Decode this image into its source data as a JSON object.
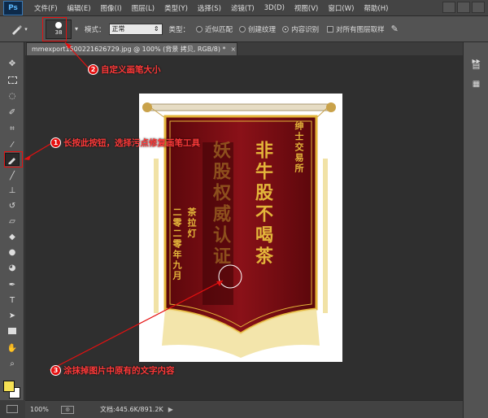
{
  "menubar": {
    "logo": "Ps",
    "items": [
      "文件(F)",
      "编辑(E)",
      "图像(I)",
      "图层(L)",
      "类型(Y)",
      "选择(S)",
      "滤镜(T)",
      "3D(D)",
      "视图(V)",
      "窗口(W)",
      "帮助(H)"
    ]
  },
  "options": {
    "brush_size": "38",
    "mode_label": "模式：",
    "mode_value": "正常",
    "type_label": "类型：",
    "radio_proximity": "近似匹配",
    "radio_texture": "创建纹理",
    "radio_content": "内容识别",
    "check_all_layers": "对所有图层取样"
  },
  "document": {
    "tab_title": "mmexport1500221626729.jpg @ 100% (背景 拷贝, RGB/8) *",
    "close": "×",
    "banner_right": "绅士交易所",
    "banner_main_right": "非牛股不喝茶",
    "banner_main_left_residue": "妖股权威认证",
    "banner_left_1": "茶拉灯",
    "banner_left_2": "二零二零年九月"
  },
  "status": {
    "zoom": "100%",
    "doc_size": "文档:445.6K/891.2K",
    "arrow": "▶"
  },
  "annotations": {
    "a1_num": "1",
    "a1_text": "长按此按钮，选择污点修复画笔工具",
    "a2_num": "2",
    "a2_text": "自定义画笔大小",
    "a3_num": "3",
    "a3_text": "涂抹掉图片中原有的文字内容"
  },
  "colors": {
    "foreground": "#f6e154",
    "background": "#ffffff",
    "annotation": "#e51010",
    "banner": "#7a0d12",
    "gold": "#e3b53a"
  }
}
